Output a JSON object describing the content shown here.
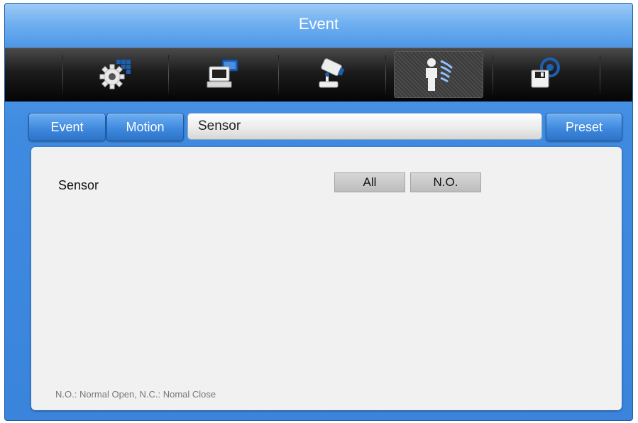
{
  "window": {
    "title": "Event"
  },
  "toolbar": {
    "items": [
      {
        "icon": "system-gear-grid-icon",
        "active": false
      },
      {
        "icon": "network-computer-icon",
        "active": false
      },
      {
        "icon": "ptz-camera-joystick-icon",
        "active": false
      },
      {
        "icon": "event-person-motion-icon",
        "active": true
      },
      {
        "icon": "storage-disk-icon",
        "active": false
      }
    ]
  },
  "tabs": {
    "event": "Event",
    "motion": "Motion",
    "current": "Sensor",
    "preset": "Preset"
  },
  "panel": {
    "sensor_label": "Sensor",
    "all_button": "All",
    "mode_button": "N.O.",
    "footnote": "N.O.: Normal Open,  N.C.: Nomal Close"
  },
  "colors": {
    "accent": "#3f8be0",
    "toolbar": "#111111",
    "panel": "#f1f1f1"
  }
}
